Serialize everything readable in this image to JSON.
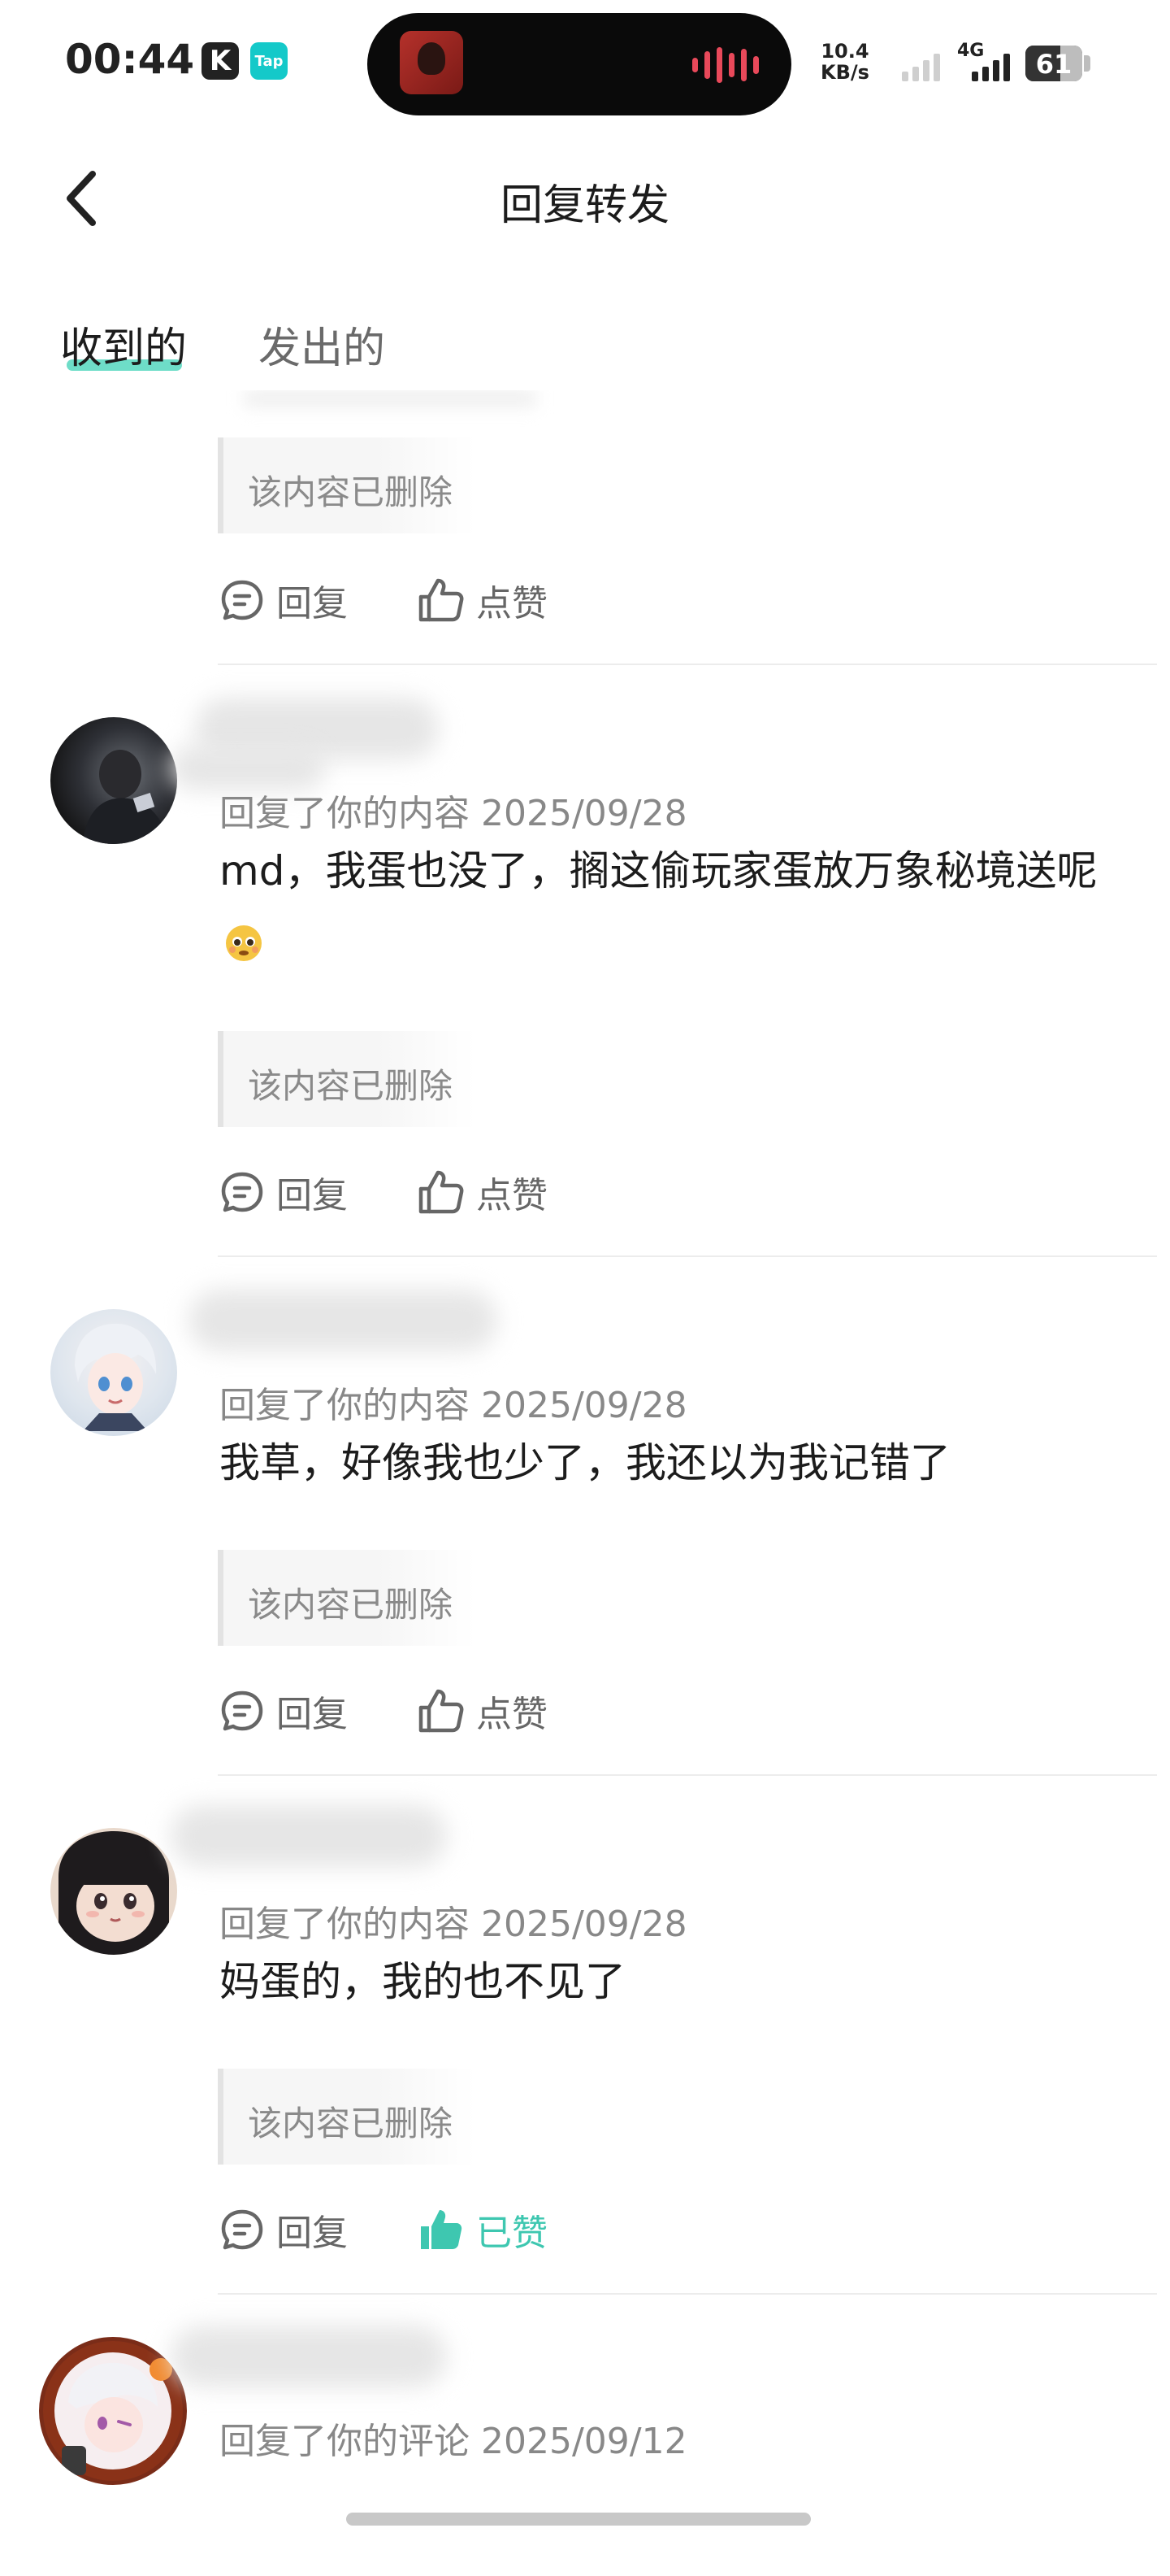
{
  "status_bar": {
    "time": "00:44",
    "app_badge_k": "K",
    "app_badge_tap": "Tap",
    "net_speed_value": "10.4",
    "net_speed_unit": "KB/s",
    "network_type": "4G",
    "battery": "61",
    "battery_level": 0.61
  },
  "header": {
    "back_icon": "chevron-left-icon",
    "title": "回复转发"
  },
  "tabs": [
    {
      "label": "收到的",
      "active": true
    },
    {
      "label": "发出的",
      "active": false
    }
  ],
  "accent_color": "#3ec7b0",
  "items": [
    {
      "quote": "该内容已删除",
      "actions": {
        "reply": "回复",
        "like": "点赞",
        "liked": false
      }
    },
    {
      "meta": "回复了你的内容 2025/09/28",
      "text": "md，我蛋也没了，搁这偷玩家蛋放万象秘境送呢",
      "emoji_icon": "pleading-face-emoji-icon",
      "quote": "该内容已删除",
      "actions": {
        "reply": "回复",
        "like": "点赞",
        "liked": false
      }
    },
    {
      "meta": "回复了你的内容 2025/09/28",
      "text": "我草，好像我也少了，我还以为我记错了",
      "quote": "该内容已删除",
      "actions": {
        "reply": "回复",
        "like": "点赞",
        "liked": false
      }
    },
    {
      "meta": "回复了你的内容 2025/09/28",
      "text": "妈蛋的，我的也不见了",
      "quote": "该内容已删除",
      "actions": {
        "reply": "回复",
        "like": "已赞",
        "liked": true
      }
    },
    {
      "meta": "回复了你的评论 2025/09/12"
    }
  ]
}
